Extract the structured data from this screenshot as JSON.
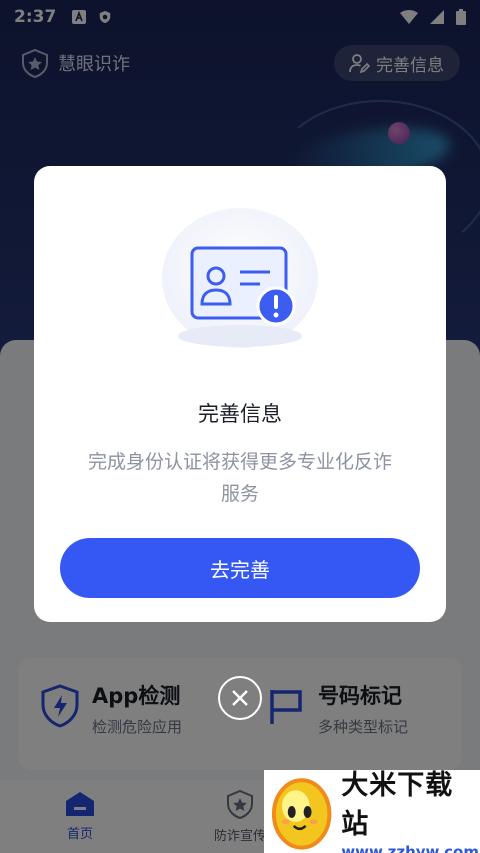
{
  "status_bar": {
    "time": "2:37"
  },
  "header": {
    "app_name": "慧眼识诈",
    "complete_info_label": "完善信息"
  },
  "features": [
    {
      "title": "App检测",
      "subtitle": "检测危险应用",
      "icon": "shield-bolt-icon"
    },
    {
      "title": "号码标记",
      "subtitle": "多种类型标记",
      "icon": "flag-icon"
    }
  ],
  "tabbar": {
    "tabs": [
      {
        "label": "首页",
        "icon": "home-icon",
        "active": true
      },
      {
        "label": "防诈宣传",
        "icon": "shield-star-icon",
        "active": false
      }
    ]
  },
  "dialog": {
    "title": "完善信息",
    "description": "完成身份认证将获得更多专业化反诈服务",
    "confirm_label": "去完善"
  },
  "watermark": {
    "title": "大米下载站",
    "url": "www.zzhyw.com"
  },
  "colors": {
    "primary": "#3557f3",
    "hero_bg": "#1a2658"
  }
}
